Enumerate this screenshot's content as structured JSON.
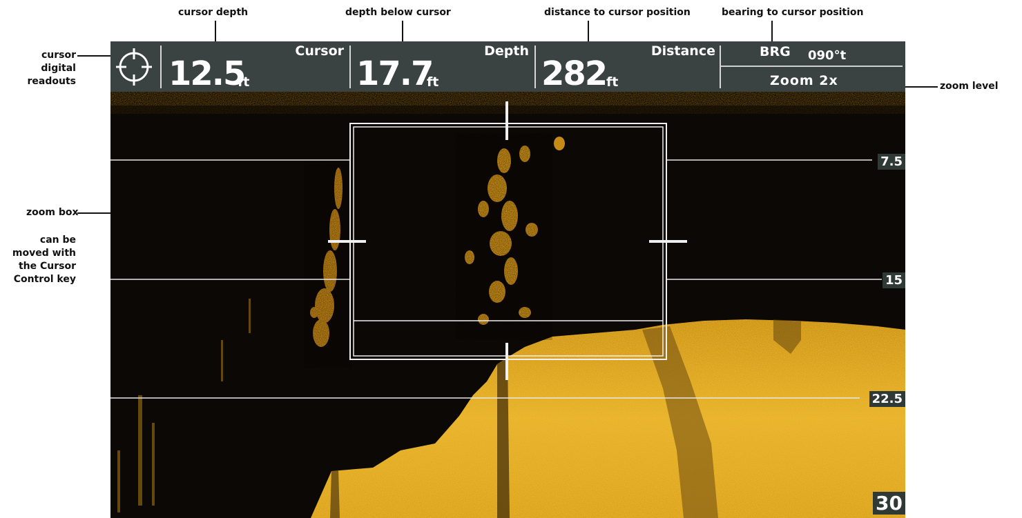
{
  "callouts": {
    "cursor_depth": "cursor depth",
    "depth_below_cursor": "depth below cursor",
    "distance_to_cursor": "distance to cursor position",
    "bearing_to_cursor": "bearing to cursor position",
    "cursor_digital_readouts": [
      "cursor",
      "digital",
      "readouts"
    ],
    "zoom_level": "zoom level",
    "zoom_box": "zoom box",
    "zoom_box_note": [
      "can be",
      "moved with",
      "the Cursor",
      "Control key"
    ]
  },
  "readouts": {
    "cursor": {
      "label": "Cursor",
      "value": "12.5",
      "unit": "ft"
    },
    "depth": {
      "label": "Depth",
      "value": "17.7",
      "unit": "ft"
    },
    "distance": {
      "label": "Distance",
      "value": "282",
      "unit": "ft"
    },
    "bearing": {
      "label": "BRG",
      "value": "090°t"
    },
    "zoom": {
      "label": "Zoom 2x"
    }
  },
  "depth_scale": [
    "7.5",
    "15",
    "22.5",
    "30"
  ],
  "colors": {
    "header_bg": "#3a4242",
    "sonar_bg": "#0c0805",
    "sonar_return": "#e2a820",
    "depth_label_bg": "#2f3a36"
  },
  "icons": {
    "cursor": "crosshair-circle-icon"
  }
}
